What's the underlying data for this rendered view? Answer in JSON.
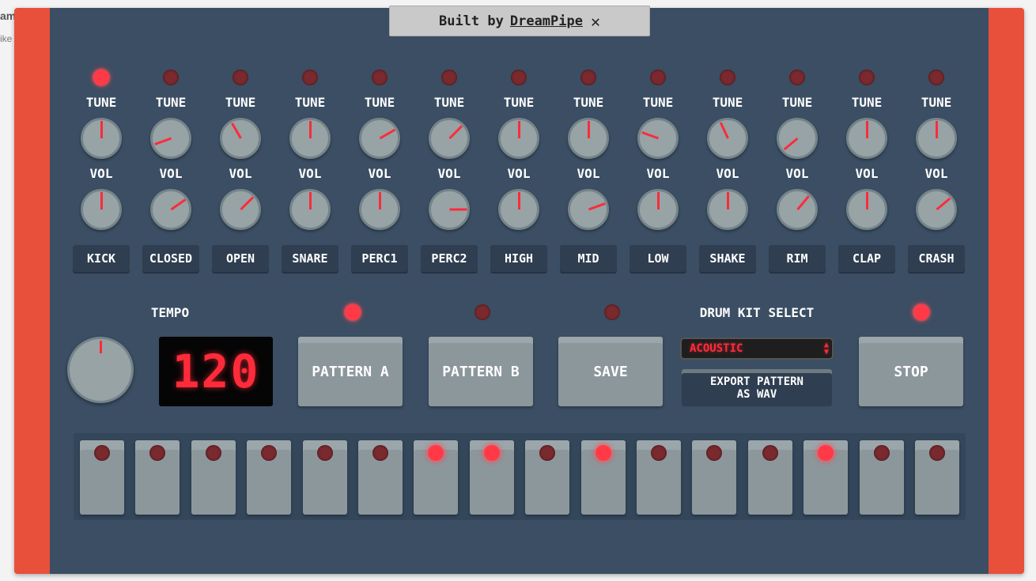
{
  "background": {
    "page_text": "am",
    "page_text2": "ike"
  },
  "banner": {
    "prefix": "Built by",
    "link": "DreamPipe",
    "close": "✕"
  },
  "colors": {
    "case": "#e8503c",
    "panel": "#3b4e63",
    "led_on": "#ff3a46",
    "led_off": "#7a2a2e",
    "knob": "#97a3a5",
    "pointer": "#ff2b3a"
  },
  "channels": [
    {
      "name": "KICK",
      "tune_label": "TUNE",
      "vol_label": "VOL",
      "led_on": true,
      "tune_angle": 180,
      "vol_angle": 180
    },
    {
      "name": "CLOSED",
      "tune_label": "TUNE",
      "vol_label": "VOL",
      "led_on": false,
      "tune_angle": 70,
      "vol_angle": 235
    },
    {
      "name": "OPEN",
      "tune_label": "TUNE",
      "vol_label": "VOL",
      "led_on": false,
      "tune_angle": 150,
      "vol_angle": 225
    },
    {
      "name": "SNARE",
      "tune_label": "TUNE",
      "vol_label": "VOL",
      "led_on": false,
      "tune_angle": 180,
      "vol_angle": 180
    },
    {
      "name": "PERC1",
      "tune_label": "TUNE",
      "vol_label": "VOL",
      "led_on": false,
      "tune_angle": 240,
      "vol_angle": 180
    },
    {
      "name": "PERC2",
      "tune_label": "TUNE",
      "vol_label": "VOL",
      "led_on": false,
      "tune_angle": 225,
      "vol_angle": 270
    },
    {
      "name": "HIGH",
      "tune_label": "TUNE",
      "vol_label": "VOL",
      "led_on": false,
      "tune_angle": 180,
      "vol_angle": 180
    },
    {
      "name": "MID",
      "tune_label": "TUNE",
      "vol_label": "VOL",
      "led_on": false,
      "tune_angle": 180,
      "vol_angle": 250
    },
    {
      "name": "LOW",
      "tune_label": "TUNE",
      "vol_label": "VOL",
      "led_on": false,
      "tune_angle": 110,
      "vol_angle": 180
    },
    {
      "name": "SHAKE",
      "tune_label": "TUNE",
      "vol_label": "VOL",
      "led_on": false,
      "tune_angle": 155,
      "vol_angle": 180
    },
    {
      "name": "RIM",
      "tune_label": "TUNE",
      "vol_label": "VOL",
      "led_on": false,
      "tune_angle": 50,
      "vol_angle": 220
    },
    {
      "name": "CLAP",
      "tune_label": "TUNE",
      "vol_label": "VOL",
      "led_on": false,
      "tune_angle": 180,
      "vol_angle": 180
    },
    {
      "name": "CRASH",
      "tune_label": "TUNE",
      "vol_label": "VOL",
      "led_on": false,
      "tune_angle": 180,
      "vol_angle": 230
    }
  ],
  "controls": {
    "tempo_label": "TEMPO",
    "tempo_value": "120",
    "pattern_a": "PATTERN A",
    "pattern_b": "PATTERN B",
    "save": "SAVE",
    "pattern_a_led": true,
    "pattern_b_led": false,
    "save_led": false,
    "kit_label": "DRUM KIT SELECT",
    "kit_value": "ACOUSTIC",
    "export_line1": "EXPORT PATTERN",
    "export_line2": "AS WAV",
    "stop": "STOP",
    "stop_led": true
  },
  "steps": [
    false,
    false,
    false,
    false,
    false,
    false,
    true,
    true,
    false,
    true,
    false,
    false,
    false,
    true,
    false,
    false
  ]
}
